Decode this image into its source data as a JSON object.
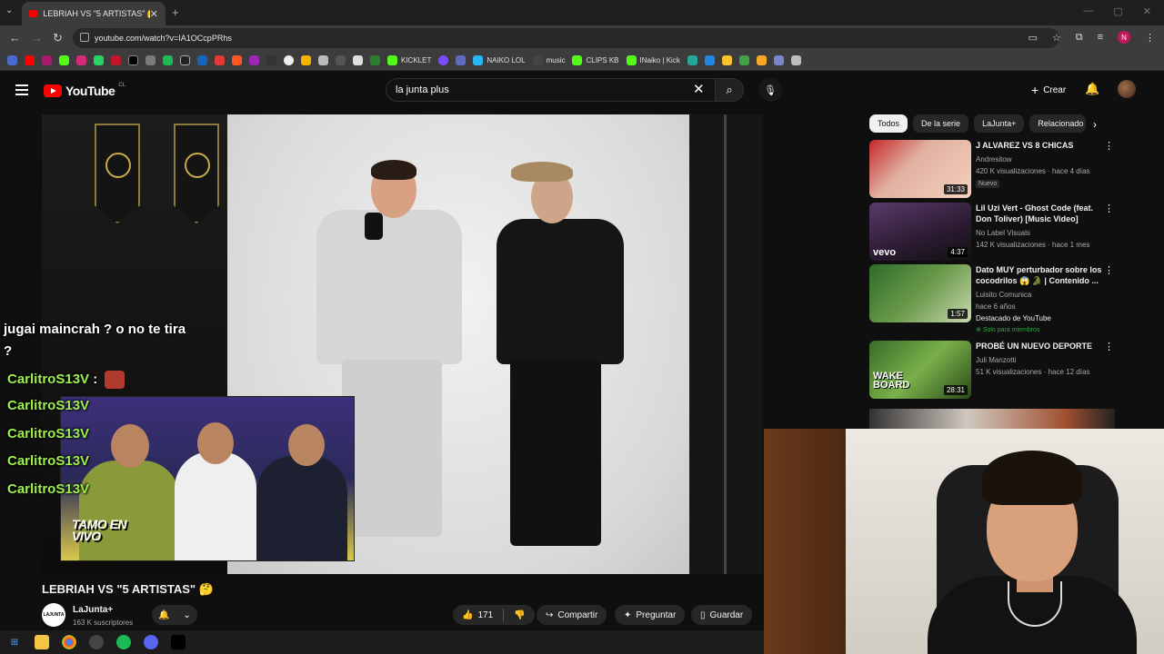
{
  "browser": {
    "tab_title": "LEBRIAH VS \"5 ARTISTAS\" 🤔",
    "url": "youtube.com/watch?v=IA1OCcpPRhs",
    "bookmarks": [
      "KICKLET",
      "NAIKO LOL",
      "music",
      "CLIPS KB",
      "INaiko | Kick"
    ],
    "profile_initial": "N"
  },
  "youtube": {
    "logo_text": "YouTube",
    "country_code": "CL",
    "search_value": "la junta plus",
    "create_label": "Crear"
  },
  "overlay": {
    "chat_message_line1": "jugai maincrah ? o no te tira",
    "chat_message_line2": "?",
    "chat_user": "CarlitroS13V",
    "pip_logo": "TAMO EN VIVO"
  },
  "video": {
    "title": "LEBRIAH VS \"5 ARTISTAS\" 🤔",
    "channel_name": "LaJunta+",
    "channel_avatar_text": "LAJUNTA",
    "subscribers": "163 K suscriptores",
    "likes": "171",
    "share_label": "Compartir",
    "ask_label": "Preguntar",
    "save_label": "Guardar"
  },
  "sidebar": {
    "chips": [
      "Todos",
      "De la serie",
      "LaJunta+",
      "Relacionado"
    ],
    "recommendations": [
      {
        "title": "J ALVAREZ VS 8 CHICAS",
        "channel": "Andresitow",
        "stats": "420 K visualizaciones · hace 4 días",
        "badge": "Nuevo",
        "duration": "31:33"
      },
      {
        "title": "Lil Uzi Vert - Ghost Code (feat. Don Toliver) [Music Video]",
        "channel": "No Label Visuals",
        "stats": "142 K visualizaciones · hace 1 mes",
        "duration": "4:37",
        "thumb_label": "vevo"
      },
      {
        "title": "Dato MUY perturbador sobre los cocodrilos 😱 🐊 | Contenido ...",
        "channel": "Luisito Comunica",
        "stats": "hace 6 años",
        "extra": "Destacado de YouTube",
        "badge": "Solo para miembros",
        "duration": "1:57"
      },
      {
        "title": "PROBÉ UN NUEVO DEPORTE",
        "channel": "Juli Manzotti",
        "stats": "51 K visualizaciones · hace 12 días",
        "duration": "28:31",
        "thumb_label": "WAKE BOARD"
      }
    ]
  },
  "colors": {
    "accent_red": "#ff0000",
    "chat_user_green": "#9ef04e",
    "background": "#0f0f0f"
  }
}
